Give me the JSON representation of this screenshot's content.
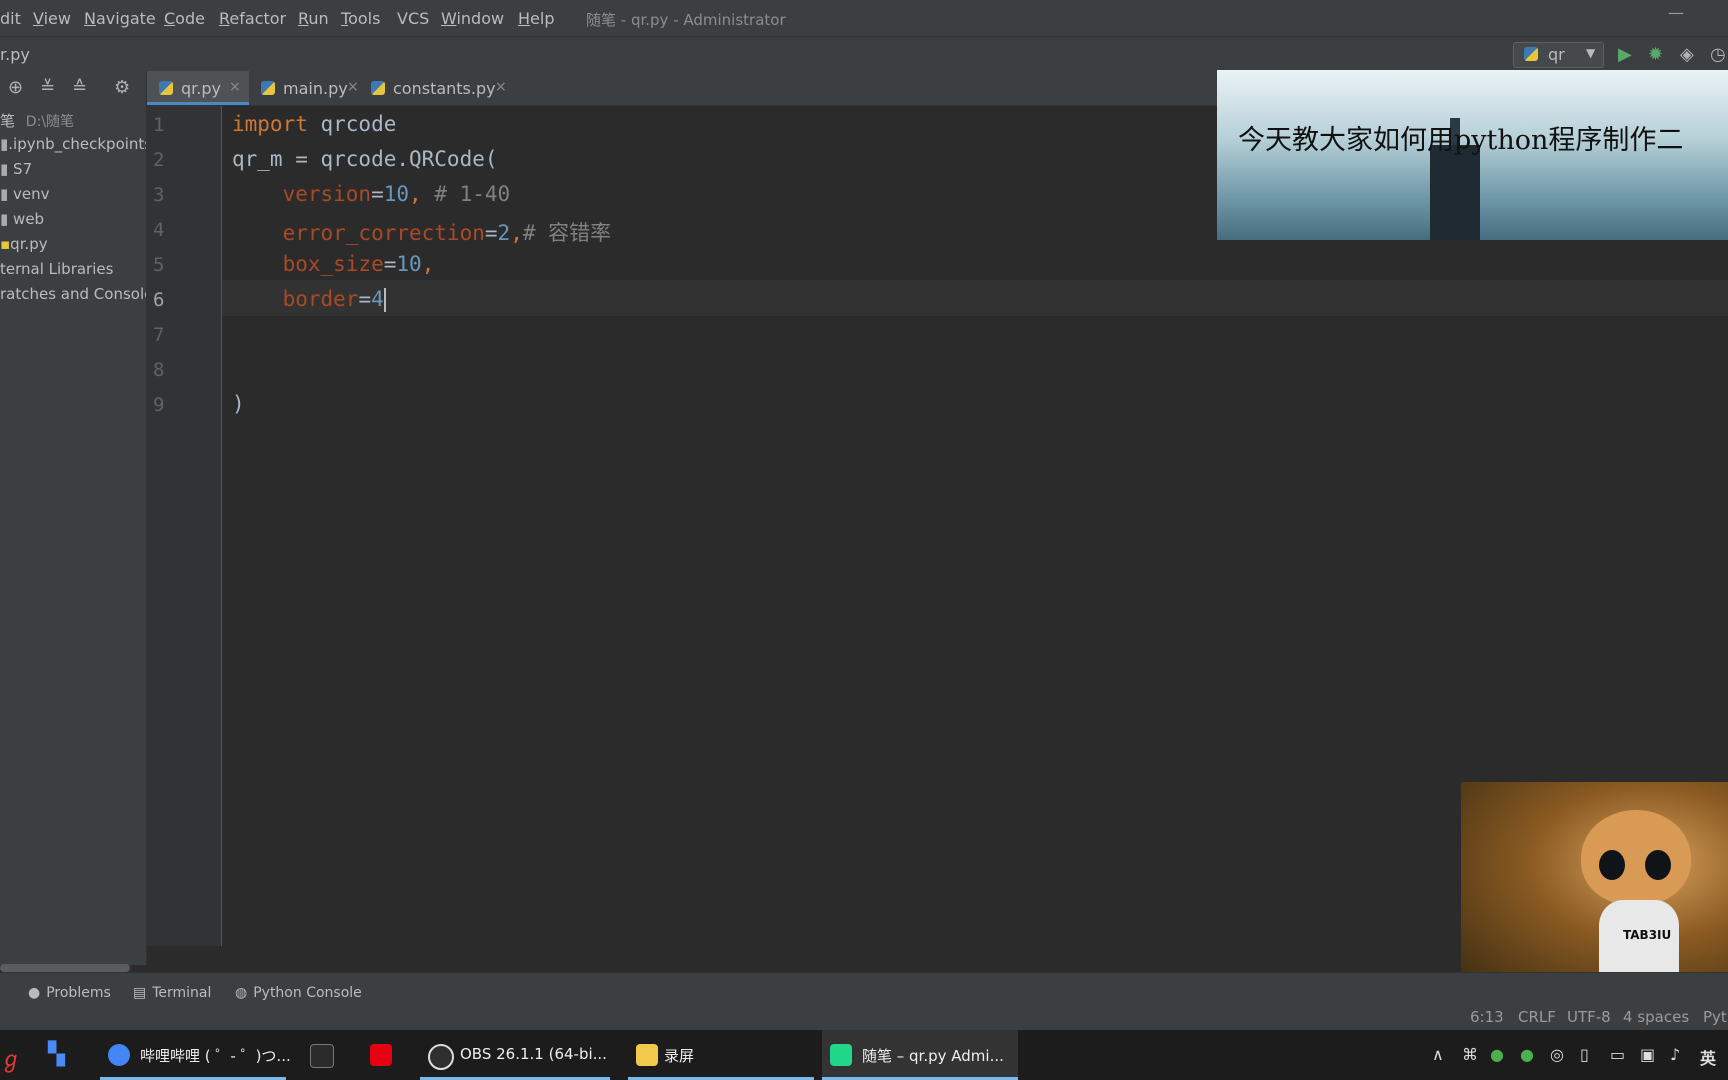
{
  "menubar": {
    "items": [
      {
        "mn": "",
        "rest": "dit"
      },
      {
        "mn": "V",
        "rest": "iew"
      },
      {
        "mn": "N",
        "rest": "avigate"
      },
      {
        "mn": "C",
        "rest": "ode"
      },
      {
        "mn": "R",
        "rest": "efactor"
      },
      {
        "mn": "R",
        "rest": "un"
      },
      {
        "mn": "T",
        "rest": "ools"
      },
      {
        "mn": "",
        "rest": "VCS"
      },
      {
        "mn": "W",
        "rest": "indow"
      },
      {
        "mn": "H",
        "rest": "elp"
      }
    ],
    "window_title": "随笔 - qr.py - Administrator",
    "minimize": "—"
  },
  "navbar": {
    "current_file": "r.py",
    "run_config": "qr",
    "run_icon": "play-icon",
    "debug_icon": "bug-icon",
    "coverage_icon": "shield-icon",
    "profile_icon": "clock-icon"
  },
  "project": {
    "toolbar_icons": [
      "locate-icon",
      "expand-all-icon",
      "collapse-all-icon",
      "gear-icon"
    ],
    "root_label": "笔",
    "root_path": "D:\\随笔",
    "items": [
      ".ipynb_checkpoints",
      "S7",
      "venv",
      "web",
      "qr.py",
      "ternal Libraries",
      "ratches and Console"
    ]
  },
  "tabs": [
    {
      "label": "qr.py",
      "close": "×"
    },
    {
      "label": "main.py",
      "close": "×"
    },
    {
      "label": "constants.py",
      "close": "×"
    }
  ],
  "editor": {
    "line_numbers": [
      "1",
      "2",
      "3",
      "4",
      "5",
      "6",
      "7",
      "8",
      "9"
    ],
    "current_line": 6,
    "lines": {
      "l1": {
        "kw": "import",
        "rest": " qrcode"
      },
      "l2": {
        "text": "qr_m = qrcode.QRCode("
      },
      "l3": {
        "indent": "    ",
        "param": "version",
        "eq": "=",
        "num": "10",
        "rest": ", ",
        "cmt": "# 1-40"
      },
      "l4": {
        "indent": "    ",
        "param": "error_correction",
        "eq": "=",
        "num": "2",
        "rest": ",",
        "cmt": "# 容错率"
      },
      "l5": {
        "indent": "    ",
        "param": "box_size",
        "eq": "=",
        "num": "10",
        "rest": ","
      },
      "l6": {
        "indent": "    ",
        "param": "border",
        "eq": "=",
        "num": "4"
      },
      "l9": {
        "text": ")"
      }
    }
  },
  "overlay": {
    "banner_text": "今天教大家如何用python程序制作二",
    "shirt_text": "TAB3IU"
  },
  "toolwindows": [
    {
      "icon": "info-icon",
      "label": "Problems"
    },
    {
      "icon": "terminal-icon",
      "label": "Terminal"
    },
    {
      "icon": "python-console-icon",
      "label": "Python Console"
    }
  ],
  "status": {
    "position": "6:13",
    "line_sep": "CRLF",
    "encoding": "UTF-8",
    "indent": "4 spaces",
    "interpreter": "Pyth"
  },
  "taskbar": {
    "apps": [
      {
        "label": "哔哩哔哩 ( ゜- ゜)つ...",
        "color": "#4285f4"
      },
      {
        "label": "",
        "color": "#2b2b2b"
      },
      {
        "label": "",
        "color": "#e60012"
      },
      {
        "label": "OBS 26.1.1 (64-bi...",
        "color": "#302e31"
      },
      {
        "label": "录屏",
        "color": "#f2c94c"
      },
      {
        "label": "随笔 – qr.py Admi...",
        "color": "#21d789"
      }
    ],
    "ime": "英"
  }
}
